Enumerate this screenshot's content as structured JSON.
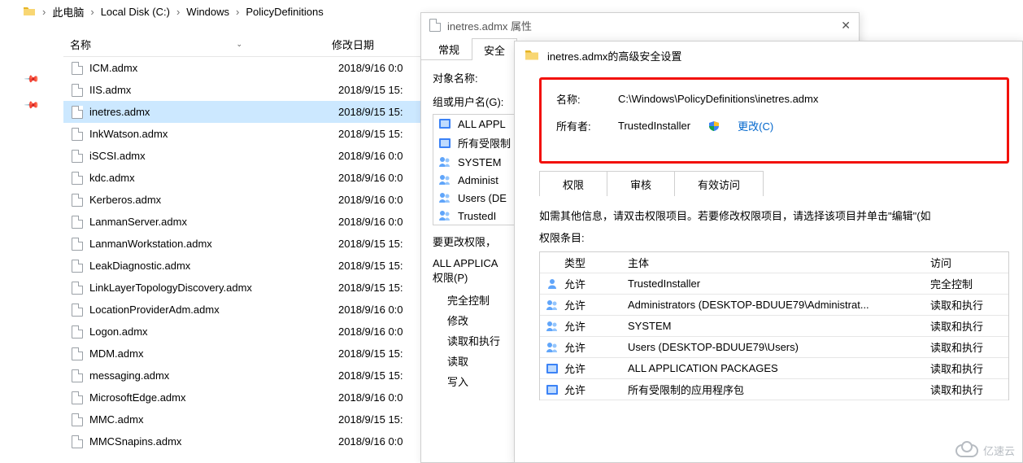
{
  "breadcrumb": [
    "此电脑",
    "Local Disk (C:)",
    "Windows",
    "PolicyDefinitions"
  ],
  "columns": {
    "name": "名称",
    "date": "修改日期"
  },
  "files": [
    {
      "name": "ICM.admx",
      "date": "2018/9/16 0:0",
      "selected": false
    },
    {
      "name": "IIS.admx",
      "date": "2018/9/15 15:",
      "selected": false
    },
    {
      "name": "inetres.admx",
      "date": "2018/9/15 15:",
      "selected": true
    },
    {
      "name": "InkWatson.admx",
      "date": "2018/9/15 15:",
      "selected": false
    },
    {
      "name": "iSCSI.admx",
      "date": "2018/9/16 0:0",
      "selected": false
    },
    {
      "name": "kdc.admx",
      "date": "2018/9/16 0:0",
      "selected": false
    },
    {
      "name": "Kerberos.admx",
      "date": "2018/9/16 0:0",
      "selected": false
    },
    {
      "name": "LanmanServer.admx",
      "date": "2018/9/16 0:0",
      "selected": false
    },
    {
      "name": "LanmanWorkstation.admx",
      "date": "2018/9/15 15:",
      "selected": false
    },
    {
      "name": "LeakDiagnostic.admx",
      "date": "2018/9/15 15:",
      "selected": false
    },
    {
      "name": "LinkLayerTopologyDiscovery.admx",
      "date": "2018/9/15 15:",
      "selected": false
    },
    {
      "name": "LocationProviderAdm.admx",
      "date": "2018/9/16 0:0",
      "selected": false
    },
    {
      "name": "Logon.admx",
      "date": "2018/9/16 0:0",
      "selected": false
    },
    {
      "name": "MDM.admx",
      "date": "2018/9/15 15:",
      "selected": false
    },
    {
      "name": "messaging.admx",
      "date": "2018/9/15 15:",
      "selected": false
    },
    {
      "name": "MicrosoftEdge.admx",
      "date": "2018/9/16 0:0",
      "selected": false
    },
    {
      "name": "MMC.admx",
      "date": "2018/9/15 15:",
      "selected": false
    },
    {
      "name": "MMCSnapins.admx",
      "date": "2018/9/16 0:0",
      "selected": false
    }
  ],
  "props": {
    "title": "inetres.admx 属性",
    "tabs": [
      "常规",
      "安全"
    ],
    "active_tab": 1,
    "object_name_label": "对象名称:",
    "group_label": "组或用户名(G):",
    "groups": [
      {
        "name": "ALL APPL",
        "icon": "group-packages"
      },
      {
        "name": "所有受限制",
        "icon": "group-packages"
      },
      {
        "name": "SYSTEM",
        "icon": "group-users"
      },
      {
        "name": "Administ",
        "icon": "group-users"
      },
      {
        "name": "Users (DE",
        "icon": "group-users"
      },
      {
        "name": "TrustedI",
        "icon": "group-users"
      }
    ],
    "change_note": "要更改权限，",
    "perm_for": "ALL APPLICA",
    "perm_for_suffix": "权限(P)",
    "perms": [
      "完全控制",
      "修改",
      "读取和执行",
      "读取",
      "写入"
    ]
  },
  "adv": {
    "title": "inetres.admx的高级安全设置",
    "name_label": "名称:",
    "name_value": "C:\\Windows\\PolicyDefinitions\\inetres.admx",
    "owner_label": "所有者:",
    "owner_value": "TrustedInstaller",
    "change_link": "更改(C)",
    "tabs": [
      "权限",
      "审核",
      "有效访问"
    ],
    "active_tab": 0,
    "helptext": "如需其他信息，请双击权限项目。若要修改权限项目，请选择该项目并单击\"编辑\"(如",
    "entries_label": "权限条目:",
    "grid_headers": {
      "type": "类型",
      "principal": "主体",
      "access": "访问"
    },
    "entries": [
      {
        "type": "允许",
        "principal": "TrustedInstaller",
        "access": "完全控制",
        "icon": "user"
      },
      {
        "type": "允许",
        "principal": "Administrators (DESKTOP-BDUUE79\\Administrat...",
        "access": "读取和执行",
        "icon": "users"
      },
      {
        "type": "允许",
        "principal": "SYSTEM",
        "access": "读取和执行",
        "icon": "users"
      },
      {
        "type": "允许",
        "principal": "Users (DESKTOP-BDUUE79\\Users)",
        "access": "读取和执行",
        "icon": "users"
      },
      {
        "type": "允许",
        "principal": "ALL APPLICATION PACKAGES",
        "access": "读取和执行",
        "icon": "package"
      },
      {
        "type": "允许",
        "principal": "所有受限制的应用程序包",
        "access": "读取和执行",
        "icon": "package"
      }
    ]
  },
  "watermark": "亿速云"
}
